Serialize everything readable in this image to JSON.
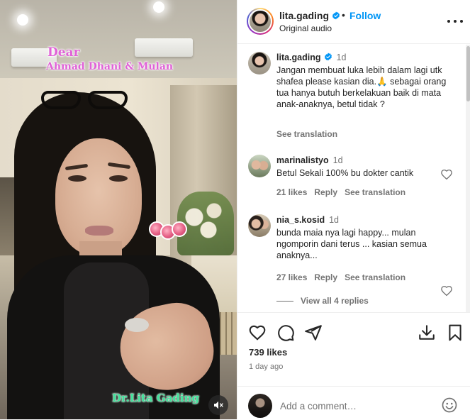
{
  "video": {
    "overlay_dear": "Dear",
    "overlay_names": "Ahmad Dhani & Mulan",
    "overlay_signature": "Dr.Lita Gading",
    "mute_icon": "speaker-muted-icon"
  },
  "header": {
    "username": "lita.gading",
    "verified": true,
    "separator": "•",
    "follow_label": "Follow",
    "audio_label": "Original audio",
    "more_icon": "more-options-icon"
  },
  "caption": {
    "username": "lita.gading",
    "time": "1d",
    "text": "Jangan membuat luka lebih dalam lagi utk shafea please kasian dia.🙏 sebagai orang tua hanya butuh berkelakuan baik di mata anak-anaknya, betul tidak ?",
    "see_translation": "See translation"
  },
  "comments": [
    {
      "username": "marinalistyo",
      "time": "1d",
      "text": "Betul Sekali 100% bu dokter cantik",
      "likes": "21 likes",
      "reply": "Reply",
      "see_translation": "See translation"
    },
    {
      "username": "nia_s.kosid",
      "time": "1d",
      "text": "bunda maia nya lagi happy... mulan ngomporin dani terus ... kasian semua anaknya...",
      "likes": "27 likes",
      "reply": "Reply",
      "see_translation": "See translation"
    }
  ],
  "view_replies": "View all 4 replies",
  "actions": {
    "likes": "739 likes",
    "posted": "1 day ago",
    "icons": [
      "heart-icon",
      "comment-icon",
      "share-icon",
      "download-icon",
      "bookmark-icon"
    ]
  },
  "add_comment": {
    "placeholder": "Add a comment…",
    "emoji_icon": "emoji-icon"
  },
  "colors": {
    "accent": "#0095f6",
    "overlay_pink": "#e062d7",
    "overlay_green": "#3fe39a",
    "text_primary": "#262626",
    "text_secondary": "#737373"
  }
}
